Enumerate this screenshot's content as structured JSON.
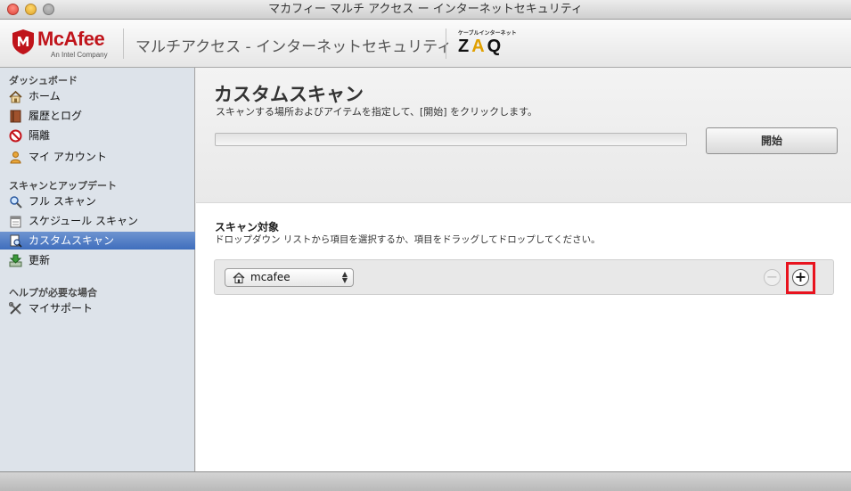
{
  "window": {
    "title": "マカフィー マルチ アクセス ー インターネットセキュリティ"
  },
  "header": {
    "brand": "McAfee",
    "brand_sub": "An Intel Company",
    "product_title": "マルチアクセス - インターネットセキュリティ",
    "partner_top": "ケーブルインターネット",
    "partner_logo_z": "Z",
    "partner_logo_a": "A",
    "partner_logo_q": "Q"
  },
  "sidebar": {
    "section_dashboard": "ダッシュボード",
    "home": "ホーム",
    "history": "履歴とログ",
    "quarantine": "隔離",
    "my_account": "マイ アカウント",
    "section_scan": "スキャンとアップデート",
    "full_scan": "フル スキャン",
    "scheduled_scan": "スケジュール スキャン",
    "custom_scan": "カスタムスキャン",
    "update": "更新",
    "section_help": "ヘルプが必要な場合",
    "my_support": "マイサポート"
  },
  "main": {
    "title": "カスタムスキャン",
    "description": "スキャンする場所およびアイテムを指定して、[開始] をクリックします。",
    "progress_percent": 0,
    "start_button": "開始",
    "target_title": "スキャン対象",
    "target_description": "ドロップダウン リストから項目を選択するか、項目をドラッグしてドロップしてください。",
    "target_selected": "mcafee",
    "remove_symbol": "−",
    "add_symbol": "+"
  },
  "colors": {
    "brand_red": "#c0141b",
    "selection_blue": "#4a78c4",
    "highlight_red": "#e8131e"
  },
  "icons": {
    "home": "home-icon",
    "history": "book-icon",
    "quarantine": "prohibited-icon",
    "account": "user-icon",
    "full_scan": "magnifier-icon",
    "scheduled": "calendar-icon",
    "custom": "document-magnifier-icon",
    "update": "download-icon",
    "support": "tools-icon"
  }
}
